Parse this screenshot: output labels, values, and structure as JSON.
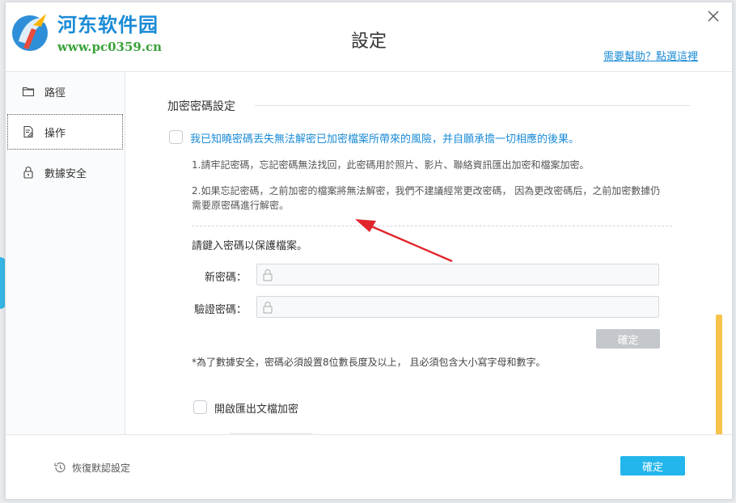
{
  "watermark": {
    "title": "河东软件园",
    "url": "www.pc0359.cn"
  },
  "dialog": {
    "title": "設定",
    "help_link": "需要幫助？點選這裡"
  },
  "sidebar": {
    "items": [
      {
        "label": "路徑",
        "icon": "folder-icon"
      },
      {
        "label": "操作",
        "icon": "document-edit-icon"
      },
      {
        "label": "數據安全",
        "icon": "lock-icon"
      }
    ],
    "active_index": 1
  },
  "content": {
    "section_title": "加密密碼設定",
    "agree_text": "我已知曉密碼丟失無法解密已加密檔案所帶來的風險，并自願承擔一切相應的後果。",
    "note1": "1.請牢記密碼，忘記密碼無法找回，此密碼用於照片、影片、聯絡資訊匯出加密和檔案加密。",
    "note2": "2.如果忘記密碼，之前加密的檔案將無法解密，我們不建議經常更改密碼， 因為更改密碼后，之前加密數據仍需要原密碼進行解密。",
    "prompt": "請鍵入密碼以保護檔案。",
    "new_password_label": "新密碼：",
    "new_password_value": "",
    "confirm_password_label": "驗證密碼：",
    "confirm_password_value": "",
    "confirm_button": "確定",
    "footnote": "*為了數據安全，密碼必須設置8位數長度及以上， 且必須包含大小寫字母和數字。",
    "export_encrypt_label": "開啟匯出文檔加密"
  },
  "footer": {
    "restore_label": "恢復默認設定",
    "ok_button": "確定"
  },
  "colors": {
    "accent": "#23b6ec",
    "link": "#1a8bd6",
    "annotation_arrow": "#e0262b",
    "scrollbar": "#f7c34b"
  }
}
